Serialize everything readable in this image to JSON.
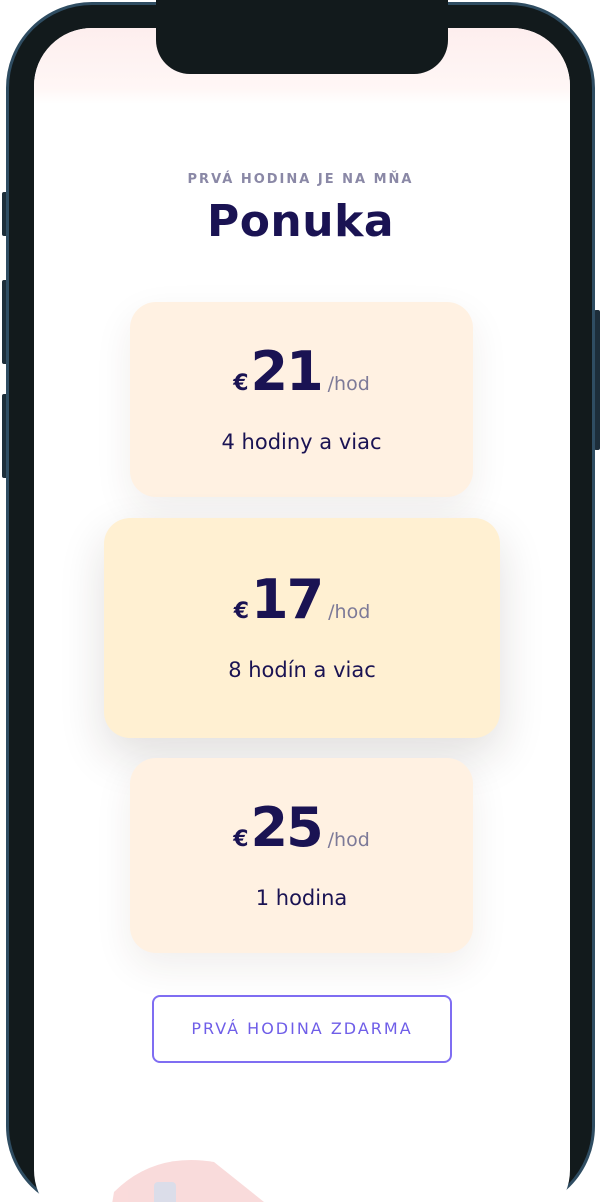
{
  "section": {
    "eyebrow": "PRVÁ HODINA JE NA MŇA",
    "title": "Ponuka"
  },
  "pricing": [
    {
      "currency": "€",
      "amount": "21",
      "per": "/hod",
      "description": "4 hodiny a viac",
      "featured": false
    },
    {
      "currency": "€",
      "amount": "17",
      "per": "/hod",
      "description": "8 hodín a viac",
      "featured": true
    },
    {
      "currency": "€",
      "amount": "25",
      "per": "/hod",
      "description": "1 hodina",
      "featured": false
    }
  ],
  "cta": {
    "label": "PRVÁ HODINA ZDARMA"
  },
  "colors": {
    "accent": "#7f6df2",
    "heading": "#1a1353",
    "card": "#fff1e2",
    "card_featured": "#fff0d2",
    "frame": "#121a1c"
  },
  "icons": {
    "decor": "illustration-fragment"
  }
}
